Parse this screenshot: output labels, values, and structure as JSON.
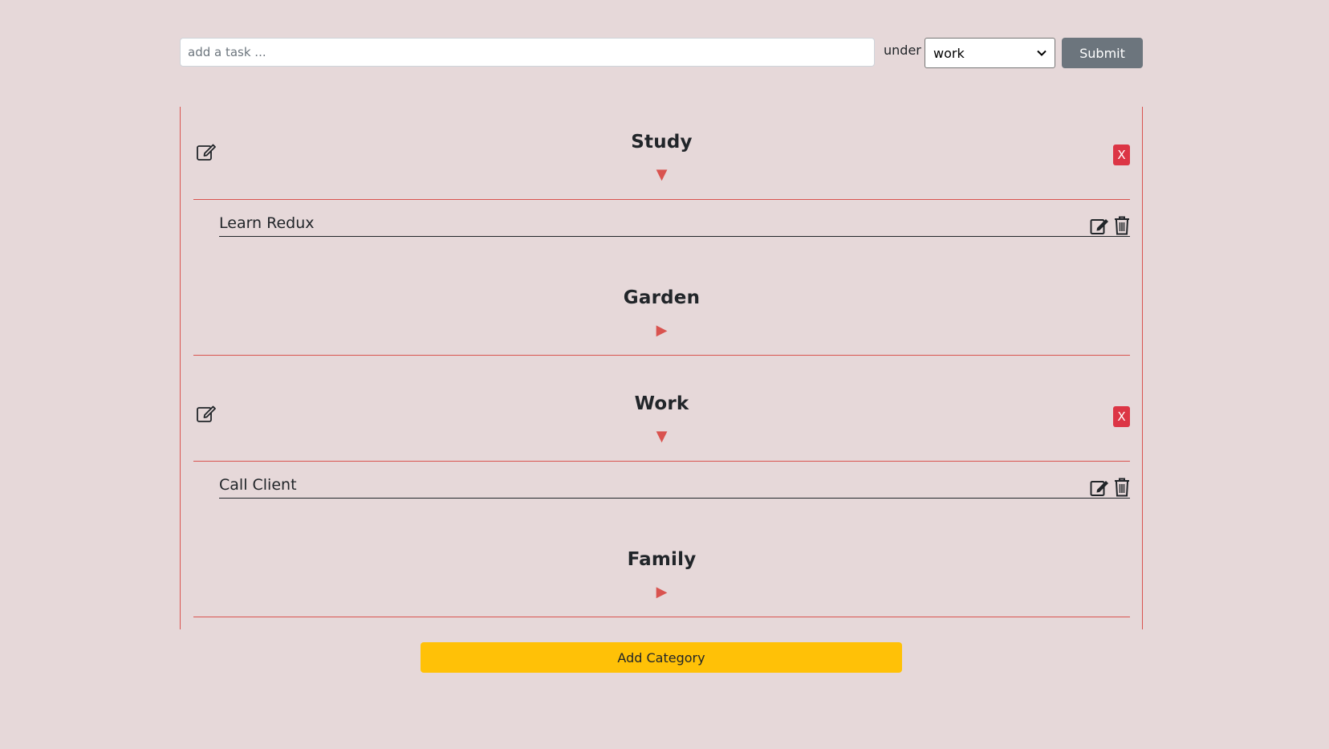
{
  "form": {
    "task_placeholder": "add a task ...",
    "task_value": "",
    "under_label": "under",
    "selected_category": "work",
    "submit_label": "Submit"
  },
  "categories": [
    {
      "title": "Study",
      "expanded": true,
      "toggle_icon": "▼",
      "tasks": [
        {
          "label": "Learn Redux"
        }
      ],
      "delete_label": "X"
    },
    {
      "title": "Garden",
      "expanded": false,
      "toggle_icon": "▶",
      "tasks": []
    },
    {
      "title": "Work",
      "expanded": true,
      "toggle_icon": "▼",
      "tasks": [
        {
          "label": "Call Client"
        }
      ],
      "delete_label": "X"
    },
    {
      "title": "Family",
      "expanded": false,
      "toggle_icon": "▶",
      "tasks": []
    }
  ],
  "add_category_label": "Add Category",
  "colors": {
    "background": "#e6d8d9",
    "accent_red": "#d9534f",
    "delete_red": "#dc3545",
    "submit_gray": "#6c757d",
    "add_yellow": "#ffc107"
  }
}
